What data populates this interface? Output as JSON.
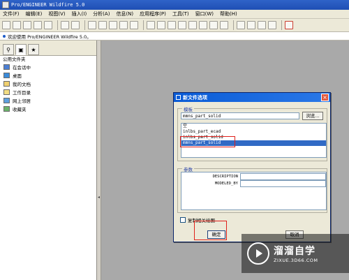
{
  "window": {
    "title": "Pro/ENGINEER Wildfire 5.0"
  },
  "menubar": {
    "items": [
      "文件(F)",
      "编辑(E)",
      "视图(V)",
      "插入(I)",
      "分析(A)",
      "信息(N)",
      "应用程序(P)",
      "工具(T)",
      "窗口(W)",
      "帮助(H)"
    ]
  },
  "statusline": {
    "message": "欢迎使用 Pro/ENGINEER Wildfire 5.0。"
  },
  "leftpanel": {
    "header": "公用文件夹",
    "items": [
      "在会话中",
      "桌面",
      "我的文档",
      "工作目录",
      "网上邻居",
      "收藏夹"
    ]
  },
  "dialog": {
    "title": "新文件选项",
    "template_group": "模板",
    "template_value": "mmns_part_solid",
    "browse": "浏览...",
    "templates": [
      "空",
      "inlbs_part_ecad",
      "inlbs_part_solid",
      "mmns_part_solid"
    ],
    "selected_index": 3,
    "params_group": "参数",
    "params": [
      {
        "name": "DESCRIPTION",
        "value": ""
      },
      {
        "name": "MODELED_BY",
        "value": ""
      }
    ],
    "copy_drawing": "复制相关绘图",
    "ok": "确定",
    "cancel": "取消"
  },
  "watermark": {
    "brand": "溜溜自学",
    "url": "ZIXUE.3D66.COM"
  },
  "colors": {
    "highlight": "#e0201a",
    "selection": "#316ac5",
    "titlebar": "#2f63c8"
  }
}
